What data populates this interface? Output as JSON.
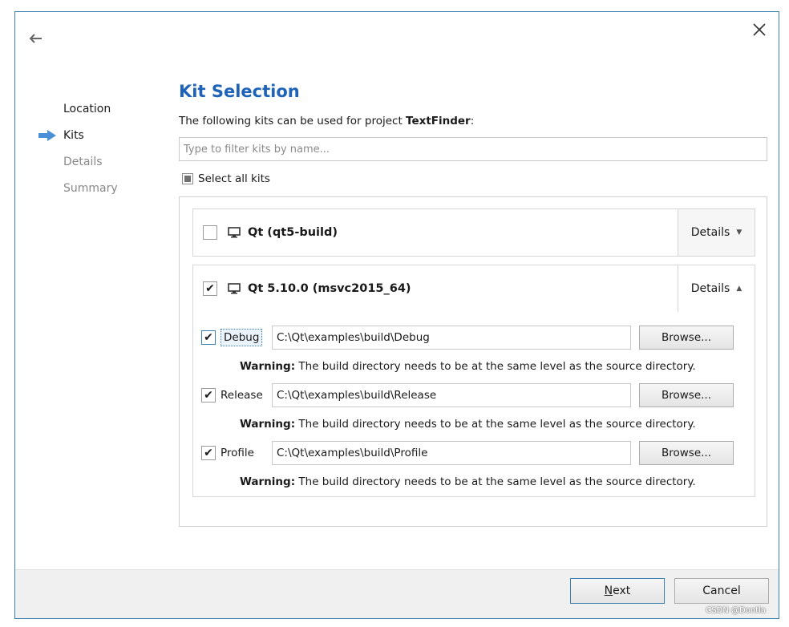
{
  "steps": [
    {
      "label": "Location",
      "state": "done"
    },
    {
      "label": "Kits",
      "state": "current"
    },
    {
      "label": "Details",
      "state": "pending"
    },
    {
      "label": "Summary",
      "state": "pending"
    }
  ],
  "page": {
    "title": "Kit Selection",
    "desc_prefix": "The following kits can be used for project ",
    "project_name": "TextFinder",
    "desc_suffix": ":"
  },
  "filter": {
    "placeholder": "Type to filter kits by name...",
    "value": ""
  },
  "select_all": {
    "label": "Select all kits",
    "state": "partial"
  },
  "kits": [
    {
      "name": "Qt  (qt5-build)",
      "checked": false,
      "details_label": "Details",
      "expanded": false
    },
    {
      "name": "Qt 5.10.0 (msvc2015_64)",
      "checked": true,
      "details_label": "Details",
      "expanded": true
    }
  ],
  "builds": [
    {
      "label": "Debug",
      "checked": true,
      "path": "C:\\Qt\\examples\\build\\Debug",
      "browse_label": "Browse...",
      "warning_prefix": "Warning:",
      "warning_text": " The build directory needs to be at the same level as the source directory."
    },
    {
      "label": "Release",
      "checked": true,
      "path": "C:\\Qt\\examples\\build\\Release",
      "browse_label": "Browse...",
      "warning_prefix": "Warning:",
      "warning_text": " The build directory needs to be at the same level as the source directory."
    },
    {
      "label": "Profile",
      "checked": true,
      "path": "C:\\Qt\\examples\\build\\Profile",
      "browse_label": "Browse...",
      "warning_prefix": "Warning:",
      "warning_text": " The build directory needs to be at the same level as the source directory."
    }
  ],
  "buttons": {
    "next_mnemonic": "N",
    "next_rest": "ext",
    "cancel": "Cancel"
  },
  "check_glyph": "✔",
  "watermark": "CSDN @Dontla",
  "colors": {
    "accent": "#1e63b8",
    "border_focus": "#3c7fb1",
    "arrow": "#4a90d9"
  }
}
